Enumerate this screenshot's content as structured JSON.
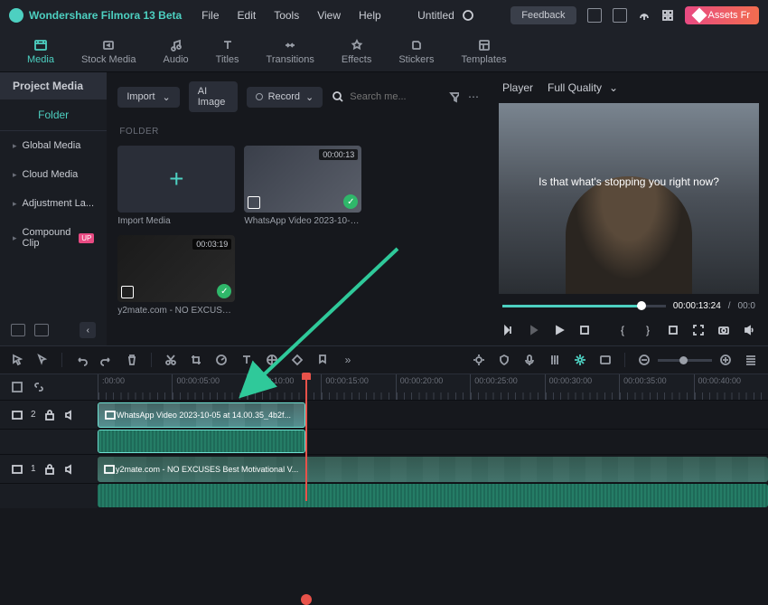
{
  "titlebar": {
    "app_name": "Wondershare Filmora 13 Beta",
    "menus": [
      "File",
      "Edit",
      "Tools",
      "View",
      "Help"
    ],
    "doc_title": "Untitled",
    "feedback": "Feedback",
    "assets": "Assets Fr"
  },
  "tabs": {
    "items": [
      {
        "label": "Media",
        "icon": "media-icon"
      },
      {
        "label": "Stock Media",
        "icon": "stock-icon"
      },
      {
        "label": "Audio",
        "icon": "audio-icon"
      },
      {
        "label": "Titles",
        "icon": "titles-icon"
      },
      {
        "label": "Transitions",
        "icon": "transitions-icon"
      },
      {
        "label": "Effects",
        "icon": "effects-icon"
      },
      {
        "label": "Stickers",
        "icon": "stickers-icon"
      },
      {
        "label": "Templates",
        "icon": "templates-icon"
      }
    ]
  },
  "sidebar": {
    "header": "Project Media",
    "folder_label": "Folder",
    "items": [
      {
        "label": "Global Media"
      },
      {
        "label": "Cloud Media"
      },
      {
        "label": "Adjustment La..."
      },
      {
        "label": "Compound Clip",
        "badge": "UP"
      }
    ]
  },
  "media_toolbar": {
    "import": "Import",
    "ai_image": "AI Image",
    "record": "Record",
    "search_placeholder": "Search me..."
  },
  "media": {
    "section": "FOLDER",
    "items": [
      {
        "name": "Import Media",
        "type": "import"
      },
      {
        "name": "WhatsApp Video 2023-10-05...",
        "duration": "00:00:13",
        "checked": true
      },
      {
        "name": "y2mate.com - NO EXCUSES ...",
        "duration": "00:03:19",
        "checked": true
      }
    ]
  },
  "player": {
    "tab": "Player",
    "quality": "Full Quality",
    "caption": "Is that what's stopping you right now?",
    "time_current": "00:00:13:24",
    "time_total": "00:0"
  },
  "timeline": {
    "ticks": [
      ":00:00",
      "00:00:05:00",
      "00:00:10:00",
      "00:00:15:00",
      "00:00:20:00",
      "00:00:25:00",
      "00:00:30:00",
      "00:00:35:00",
      "00:00:40:00"
    ],
    "tracks": [
      {
        "id": "2",
        "type": "video",
        "clip": "WhatsApp Video 2023-10-05 at 14.00.35_4b2f..."
      },
      {
        "id": "1",
        "type": "video",
        "clip": "y2mate.com - NO EXCUSES  Best Motivational V..."
      }
    ]
  }
}
